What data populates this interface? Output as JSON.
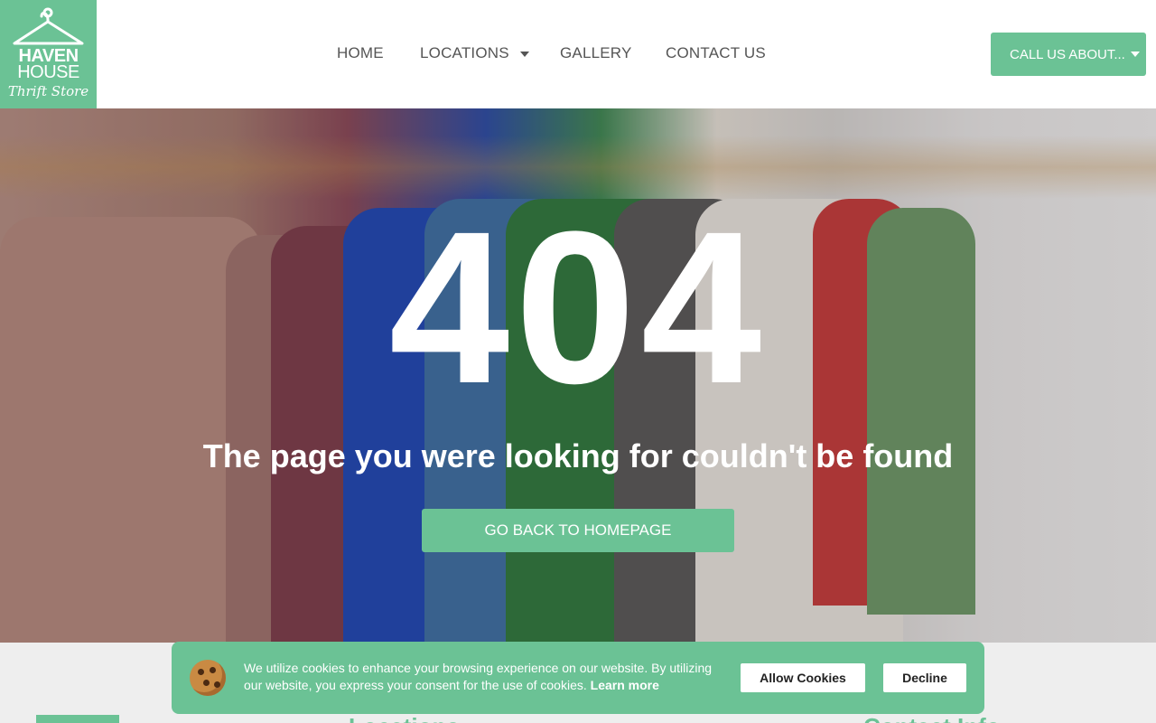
{
  "brand": {
    "line1": "HAVEN",
    "line2": "HOUSE",
    "line3": "Thrift Store"
  },
  "nav": {
    "items": [
      {
        "label": "HOME"
      },
      {
        "label": "LOCATIONS",
        "has_dropdown": true
      },
      {
        "label": "GALLERY"
      },
      {
        "label": "CONTACT US"
      }
    ],
    "call_label": "CALL US ABOUT..."
  },
  "error": {
    "code": "404",
    "message": "The page you were looking for couldn't be found",
    "button_label": "GO BACK TO HOMEPAGE"
  },
  "footer": {
    "locations_heading": "Locations",
    "contact_heading": "Contact Info"
  },
  "cookie": {
    "text": "We utilize cookies to enhance your browsing experience on our website. By utilizing our website, you express your consent for the use of cookies.",
    "learn_more": "Learn more",
    "allow": "Allow Cookies",
    "decline": "Decline"
  },
  "colors": {
    "accent": "#6bc295",
    "white": "#ffffff",
    "nav_text": "#555555"
  },
  "icons": [
    "hanger-icon",
    "chevron-down-icon",
    "cookie-icon"
  ]
}
